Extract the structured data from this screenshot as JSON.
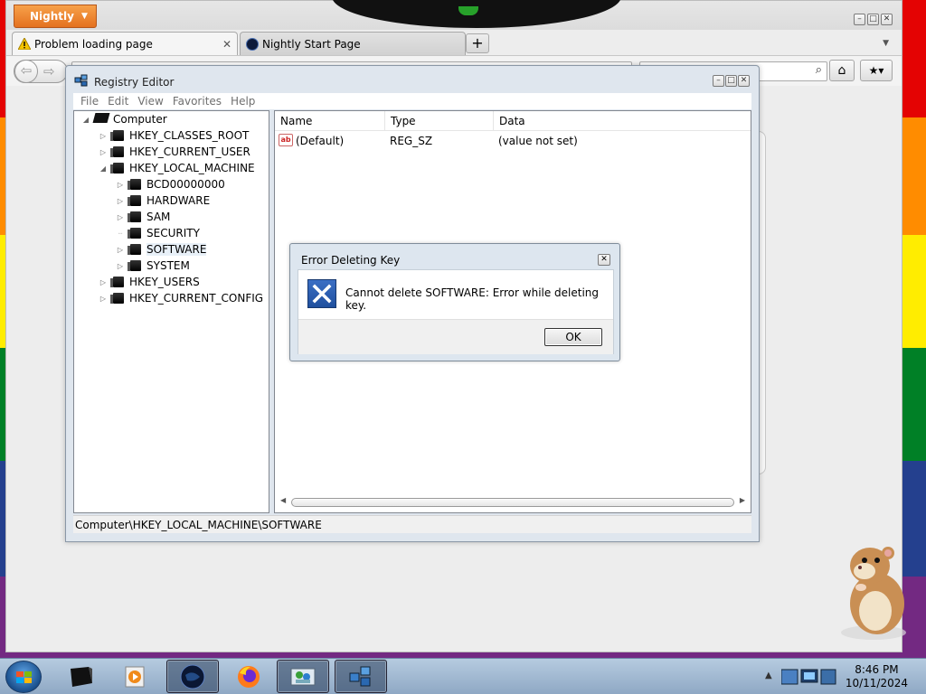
{
  "desktop": {
    "stripe_colors": [
      "#e40303",
      "#ff8c00",
      "#ffed00",
      "#008026",
      "#24408e",
      "#732982"
    ]
  },
  "browser": {
    "app_button": "Nightly",
    "tabs": [
      {
        "label": "Problem loading page",
        "icon": "warning-icon",
        "active": true
      },
      {
        "label": "Nightly Start Page",
        "icon": "nightly-icon",
        "active": false
      }
    ],
    "new_tab": "+"
  },
  "regedit": {
    "title": "Registry Editor",
    "menu": [
      "File",
      "Edit",
      "View",
      "Favorites",
      "Help"
    ],
    "tree": {
      "root": "Computer",
      "hives": [
        "HKEY_CLASSES_ROOT",
        "HKEY_CURRENT_USER",
        "HKEY_LOCAL_MACHINE"
      ],
      "hklm_children": [
        "BCD00000000",
        "HARDWARE",
        "SAM",
        "SECURITY",
        "SOFTWARE",
        "SYSTEM"
      ],
      "hives_after": [
        "HKEY_USERS",
        "HKEY_CURRENT_CONFIG"
      ],
      "selected": "SOFTWARE"
    },
    "list": {
      "columns": [
        "Name",
        "Type",
        "Data"
      ],
      "rows": [
        {
          "name": "(Default)",
          "type": "REG_SZ",
          "data": "(value not set)"
        }
      ],
      "value_icon": "ab"
    },
    "status": "Computer\\HKEY_LOCAL_MACHINE\\SOFTWARE"
  },
  "dialog": {
    "title": "Error Deleting Key",
    "message": "Cannot delete SOFTWARE:  Error while deleting key.",
    "ok_label": "OK",
    "icon": "error-x-icon"
  },
  "taskbar": {
    "items": [
      {
        "name": "monitor-app-icon",
        "active": false
      },
      {
        "name": "media-player-icon",
        "active": false
      },
      {
        "name": "globe-app-icon",
        "active": true
      },
      {
        "name": "firefox-icon",
        "active": false
      },
      {
        "name": "people-app-icon",
        "active": true
      },
      {
        "name": "regedit-icon",
        "active": true
      }
    ],
    "clock_time": "8:46 PM",
    "clock_date": "10/11/2024"
  }
}
